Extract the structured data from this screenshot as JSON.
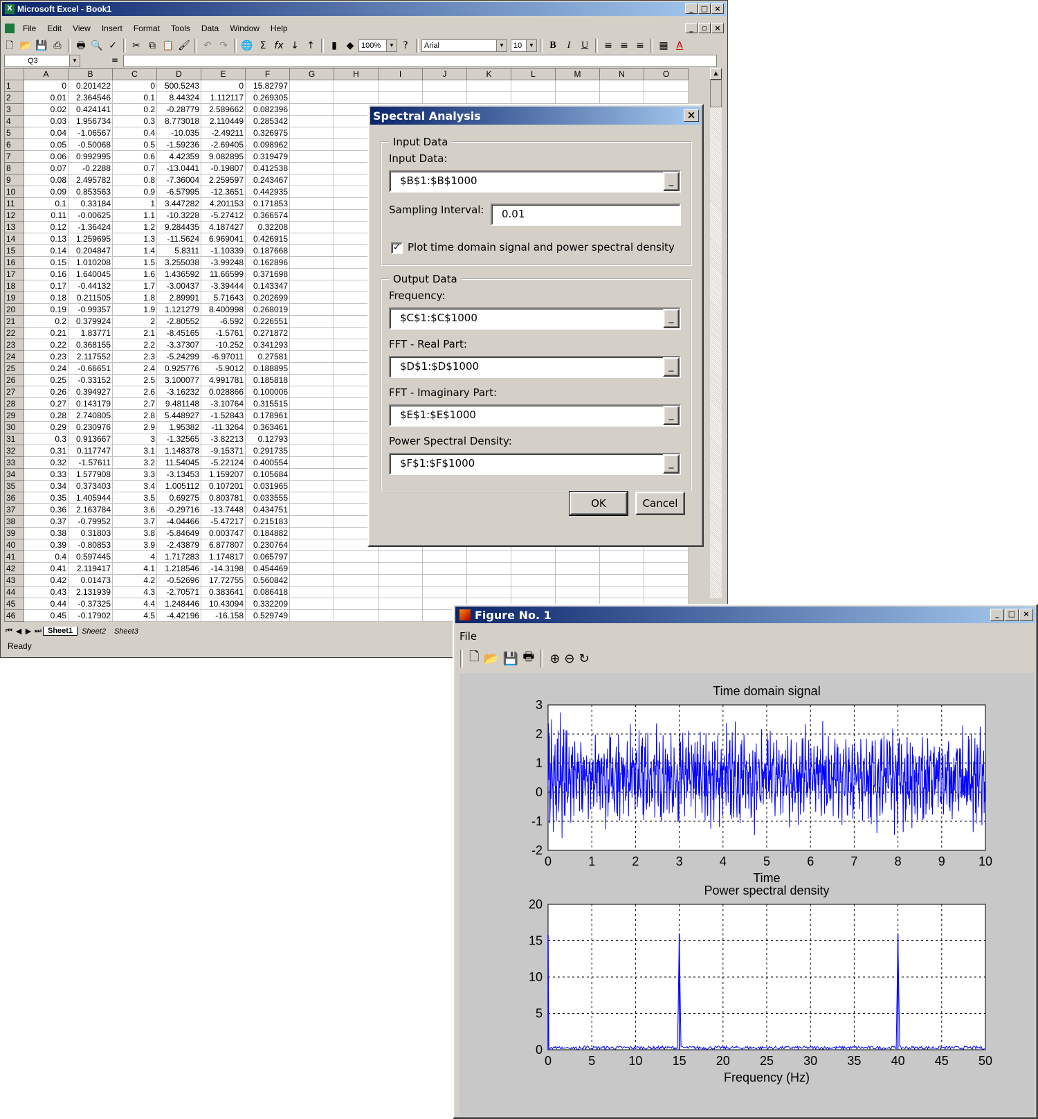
{
  "excel": {
    "title": "Microsoft Excel - Book1",
    "menu": [
      "File",
      "Edit",
      "View",
      "Insert",
      "Format",
      "Tools",
      "Data",
      "Window",
      "Help"
    ],
    "zoom": "100%",
    "font_name": "Arial",
    "font_size": "10",
    "name_box": "Q3",
    "formula_eq": "=",
    "columns": [
      "A",
      "B",
      "C",
      "D",
      "E",
      "F",
      "G",
      "H",
      "I",
      "J",
      "K",
      "L",
      "M",
      "N",
      "O"
    ],
    "rows": [
      [
        "1",
        "0",
        "0.201422",
        "0",
        "500.5243",
        "0",
        "15.82797"
      ],
      [
        "2",
        "0.01",
        "2.364546",
        "0.1",
        "8.44324",
        "1.112117",
        "0.269305"
      ],
      [
        "3",
        "0.02",
        "0.424141",
        "0.2",
        "-0.28779",
        "2.589662",
        "0.082396"
      ],
      [
        "4",
        "0.03",
        "1.956734",
        "0.3",
        "8.773018",
        "2.110449",
        "0.285342"
      ],
      [
        "5",
        "0.04",
        "-1.06567",
        "0.4",
        "-10.035",
        "-2.49211",
        "0.326975"
      ],
      [
        "6",
        "0.05",
        "-0.50068",
        "0.5",
        "-1.59236",
        "-2.69405",
        "0.098962"
      ],
      [
        "7",
        "0.06",
        "0.992995",
        "0.6",
        "4.42359",
        "9.082895",
        "0.319479"
      ],
      [
        "8",
        "0.07",
        "-0.2288",
        "0.7",
        "-13.0441",
        "-0.19807",
        "0.412538"
      ],
      [
        "9",
        "0.08",
        "2.495782",
        "0.8",
        "-7.36004",
        "2.259597",
        "0.243467"
      ],
      [
        "10",
        "0.09",
        "0.853563",
        "0.9",
        "-6.57995",
        "-12.3651",
        "0.442935"
      ],
      [
        "11",
        "0.1",
        "0.33184",
        "1",
        "3.447282",
        "4.201153",
        "0.171853"
      ],
      [
        "12",
        "0.11",
        "-0.00625",
        "1.1",
        "-10.3228",
        "-5.27412",
        "0.366574"
      ],
      [
        "13",
        "0.12",
        "-1.36424",
        "1.2",
        "9.284435",
        "4.187427",
        "0.32208"
      ],
      [
        "14",
        "0.13",
        "1.259695",
        "1.3",
        "-11.5624",
        "6.969041",
        "0.426915"
      ],
      [
        "15",
        "0.14",
        "0.204847",
        "1.4",
        "5.8311",
        "-1.10339",
        "0.187668"
      ],
      [
        "16",
        "0.15",
        "1.010208",
        "1.5",
        "3.255038",
        "-3.99248",
        "0.162896"
      ],
      [
        "17",
        "0.16",
        "1.640045",
        "1.6",
        "1.436592",
        "11.66599",
        "0.371698"
      ],
      [
        "18",
        "0.17",
        "-0.44132",
        "1.7",
        "-3.00437",
        "-3.39444",
        "0.143347"
      ],
      [
        "19",
        "0.18",
        "0.211505",
        "1.8",
        "2.89991",
        "5.71643",
        "0.202699"
      ],
      [
        "20",
        "0.19",
        "-0.99357",
        "1.9",
        "1.121279",
        "8.400998",
        "0.268019"
      ],
      [
        "21",
        "0.2",
        "0.379924",
        "2",
        "-2.80552",
        "-6.592",
        "0.226551"
      ],
      [
        "22",
        "0.21",
        "1.83771",
        "2.1",
        "-8.45165",
        "-1.5761",
        "0.271872"
      ],
      [
        "23",
        "0.22",
        "0.368155",
        "2.2",
        "-3.37307",
        "-10.252",
        "0.341293"
      ],
      [
        "24",
        "0.23",
        "2.117552",
        "2.3",
        "-5.24299",
        "-6.97011",
        "0.27581"
      ],
      [
        "25",
        "0.24",
        "-0.66651",
        "2.4",
        "0.925776",
        "-5.9012",
        "0.188895"
      ],
      [
        "26",
        "0.25",
        "-0.33152",
        "2.5",
        "3.100077",
        "4.991781",
        "0.185818"
      ],
      [
        "27",
        "0.26",
        "0.394927",
        "2.6",
        "-3.16232",
        "0.028866",
        "0.100006"
      ],
      [
        "28",
        "0.27",
        "0.143179",
        "2.7",
        "9.481148",
        "-3.10764",
        "0.315515"
      ],
      [
        "29",
        "0.28",
        "2.740805",
        "2.8",
        "5.448927",
        "-1.52843",
        "0.178961"
      ],
      [
        "30",
        "0.29",
        "0.230976",
        "2.9",
        "1.95382",
        "-11.3264",
        "0.363461"
      ],
      [
        "31",
        "0.3",
        "0.913667",
        "3",
        "-1.32565",
        "-3.82213",
        "0.12793"
      ],
      [
        "32",
        "0.31",
        "0.117747",
        "3.1",
        "1.148378",
        "-9.15371",
        "0.291735"
      ],
      [
        "33",
        "0.32",
        "-1.57611",
        "3.2",
        "11.54045",
        "-5.22124",
        "0.400554"
      ],
      [
        "34",
        "0.33",
        "1.577908",
        "3.3",
        "-3.13453",
        "1.159207",
        "0.105684"
      ],
      [
        "35",
        "0.34",
        "0.373403",
        "3.4",
        "1.005112",
        "0.107201",
        "0.031965"
      ],
      [
        "36",
        "0.35",
        "1.405944",
        "3.5",
        "0.69275",
        "0.803781",
        "0.033555"
      ],
      [
        "37",
        "0.36",
        "2.163784",
        "3.6",
        "-0.29716",
        "-13.7448",
        "0.434751"
      ],
      [
        "38",
        "0.37",
        "-0.79952",
        "3.7",
        "-4.04466",
        "-5.47217",
        "0.215183"
      ],
      [
        "39",
        "0.38",
        "0.31803",
        "3.8",
        "-5.84649",
        "0.003747",
        "0.184882"
      ],
      [
        "40",
        "0.39",
        "-0.80853",
        "3.9",
        "-2.43879",
        "6.877807",
        "0.230764"
      ],
      [
        "41",
        "0.4",
        "0.597445",
        "4",
        "1.717283",
        "1.174817",
        "0.065797"
      ],
      [
        "42",
        "0.41",
        "2.119417",
        "4.1",
        "1.218546",
        "-14.3198",
        "0.454469"
      ],
      [
        "43",
        "0.42",
        "0.01473",
        "4.2",
        "-0.52696",
        "17.72755",
        "0.560842"
      ],
      [
        "44",
        "0.43",
        "2.131939",
        "4.3",
        "-2.70571",
        "0.383641",
        "0.086418"
      ],
      [
        "45",
        "0.44",
        "-0.37325",
        "4.4",
        "1.248446",
        "10.43094",
        "0.332209"
      ],
      [
        "46",
        "0.45",
        "-0.17902",
        "4.5",
        "-4.42196",
        "-16.158",
        "0.529749"
      ]
    ],
    "sheets": [
      "Sheet1",
      "Sheet2",
      "Sheet3"
    ],
    "status": "Ready"
  },
  "dialog": {
    "title": "Spectral Analysis",
    "input_group": "Input Data",
    "input_label": "Input Data:",
    "input_value": "$B$1:$B$1000",
    "sampling_label": "Sampling Interval:",
    "sampling_value": "0.01",
    "plot_checkbox_label": "Plot time domain signal and power spectral density",
    "plot_checked": true,
    "output_group": "Output Data",
    "freq_label": "Frequency:",
    "freq_value": "$C$1:$C$1000",
    "real_label": "FFT - Real Part:",
    "real_value": "$D$1:$D$1000",
    "imag_label": "FFT - Imaginary Part:",
    "imag_value": "$E$1:$E$1000",
    "psd_label": "Power Spectral Density:",
    "psd_value": "$F$1:$F$1000",
    "ok": "OK",
    "cancel": "Cancel"
  },
  "figure": {
    "title": "Figure No. 1",
    "menu": "File"
  },
  "chart_data": [
    {
      "type": "line",
      "title": "Time domain signal",
      "xlabel": "Time",
      "ylabel": "",
      "xlim": [
        0,
        10
      ],
      "ylim": [
        -2,
        3
      ],
      "xticks": [
        "0",
        "1",
        "2",
        "3",
        "4",
        "5",
        "6",
        "7",
        "8",
        "9",
        "10"
      ],
      "yticks": [
        "3",
        "2",
        "1",
        "0",
        "-1",
        "-2"
      ],
      "color": "#0000ff",
      "grid": true,
      "x": [
        0,
        0.01,
        0.02,
        0.03,
        0.04,
        0.05,
        0.06,
        0.07,
        0.08,
        0.09,
        0.1,
        0.11,
        0.12,
        0.13,
        0.14,
        0.15,
        0.16,
        0.17,
        0.18,
        0.19,
        0.2,
        0.21,
        0.22,
        0.23,
        0.24,
        0.25,
        0.26,
        0.27,
        0.28,
        0.29,
        0.3,
        0.31,
        0.32,
        0.33,
        0.34,
        0.35,
        0.36,
        0.37,
        0.38,
        0.39,
        0.4,
        0.41,
        0.42,
        0.43,
        0.44,
        0.45
      ],
      "y": [
        0.201422,
        2.364546,
        0.424141,
        1.956734,
        -1.06567,
        -0.50068,
        0.992995,
        -0.2288,
        2.495782,
        0.853563,
        0.33184,
        -0.00625,
        -1.36424,
        1.259695,
        0.204847,
        1.010208,
        1.640045,
        -0.44132,
        0.211505,
        -0.99357,
        0.379924,
        1.83771,
        0.368155,
        2.117552,
        -0.66651,
        -0.33152,
        0.394927,
        0.143179,
        2.740805,
        0.230976,
        0.913667,
        0.117747,
        -1.57611,
        1.577908,
        0.373403,
        1.405944,
        2.163784,
        -0.79952,
        0.31803,
        -0.80853,
        0.597445,
        2.119417,
        0.01473,
        2.131939,
        -0.37325,
        -0.17902
      ]
    },
    {
      "type": "line",
      "title": "Power spectral density",
      "xlabel": "Frequency (Hz)",
      "ylabel": "",
      "xlim": [
        0,
        50
      ],
      "ylim": [
        0,
        20
      ],
      "xticks": [
        "0",
        "5",
        "10",
        "15",
        "20",
        "25",
        "30",
        "35",
        "40",
        "45",
        "50"
      ],
      "yticks": [
        "20",
        "15",
        "10",
        "5",
        "0"
      ],
      "color": "#0000ff",
      "grid": true,
      "peaks": [
        {
          "x": 0,
          "y": 15.8
        },
        {
          "x": 15,
          "y": 15.9
        },
        {
          "x": 40,
          "y": 15.9
        }
      ],
      "x": [
        0,
        0.1,
        0.2,
        0.3,
        0.4,
        0.5,
        0.6,
        0.7,
        0.8,
        0.9,
        1,
        1.1,
        1.2,
        1.3,
        1.4,
        1.5,
        1.6,
        1.7,
        1.8,
        1.9,
        2,
        2.1,
        2.2,
        2.3,
        2.4,
        2.5,
        2.6,
        2.7,
        2.8,
        2.9,
        3,
        3.1,
        3.2,
        3.3,
        3.4,
        3.5,
        3.6,
        3.7,
        3.8,
        3.9,
        4,
        4.1,
        4.2,
        4.3,
        4.4,
        4.5
      ],
      "y": [
        15.82797,
        0.269305,
        0.082396,
        0.285342,
        0.326975,
        0.098962,
        0.319479,
        0.412538,
        0.243467,
        0.442935,
        0.171853,
        0.366574,
        0.32208,
        0.426915,
        0.187668,
        0.162896,
        0.371698,
        0.143347,
        0.202699,
        0.268019,
        0.226551,
        0.271872,
        0.341293,
        0.27581,
        0.188895,
        0.185818,
        0.100006,
        0.315515,
        0.178961,
        0.363461,
        0.12793,
        0.291735,
        0.400554,
        0.105684,
        0.031965,
        0.033555,
        0.434751,
        0.215183,
        0.184882,
        0.230764,
        0.065797,
        0.454469,
        0.560842,
        0.086418,
        0.332209,
        0.529749
      ]
    }
  ]
}
